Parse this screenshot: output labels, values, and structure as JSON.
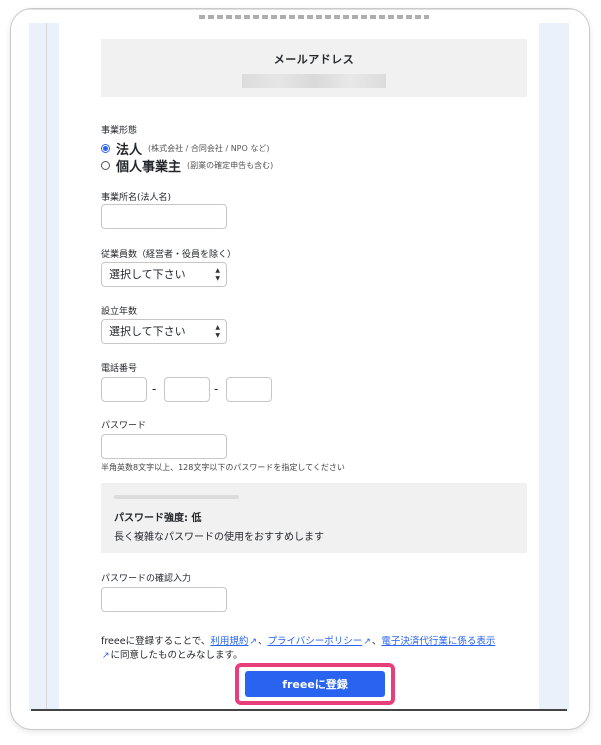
{
  "email_section": {
    "title": "メールアドレス"
  },
  "business_type": {
    "label": "事業形態",
    "options": [
      {
        "main": "法人",
        "sub": "(株式会社 / 合同会社 / NPO など)",
        "selected": true
      },
      {
        "main": "個人事業主",
        "sub": "(副業の確定申告も含む)",
        "selected": false
      }
    ]
  },
  "office_name": {
    "label": "事業所名(法人名)",
    "value": ""
  },
  "employees": {
    "label": "従業員数（経営者・役員を除く）",
    "selected": "選択して下さい"
  },
  "founding_year": {
    "label": "設立年数",
    "selected": "選択して下さい"
  },
  "phone": {
    "label": "電話番号",
    "separator": "-"
  },
  "password": {
    "label": "パスワード",
    "hint": "半角英数8文字以上、128文字以下のパスワードを指定してください"
  },
  "strength": {
    "title": "パスワード強度: 低",
    "message": "長く複雑なパスワードの使用をおすすめします"
  },
  "password_confirm": {
    "label": "パスワードの確認入力"
  },
  "terms": {
    "prefix": "freeeに登録することで、",
    "link1": "利用規約",
    "sep": "、",
    "link2": "プライバシーポリシー",
    "link3": "電子決済代行業に係る表示",
    "suffix": "に同意したものとみなします。"
  },
  "submit": {
    "label": "freeeに登録"
  },
  "colors": {
    "accent": "#2864f0",
    "highlight": "#e83e7c",
    "panel": "#f1f1f1",
    "side": "#ebf1fb"
  }
}
